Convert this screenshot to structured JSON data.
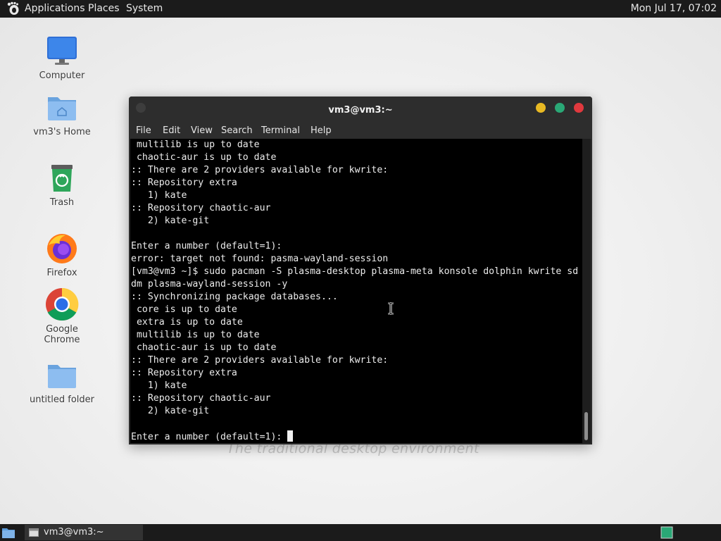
{
  "top_panel": {
    "menus": [
      "Applications",
      "Places",
      "System"
    ],
    "clock": "Mon Jul 17, 07:02"
  },
  "desktop": {
    "icons": [
      {
        "label": "Computer",
        "icon": "monitor-icon"
      },
      {
        "label": "vm3's Home",
        "icon": "home-folder-icon"
      },
      {
        "label": "Trash",
        "icon": "trash-icon"
      },
      {
        "label": "Firefox",
        "icon": "firefox-icon"
      },
      {
        "label": "Google Chrome",
        "icon": "chrome-icon"
      },
      {
        "label": "untitled folder",
        "icon": "folder-icon"
      }
    ],
    "wallpaper_text": "The traditional desktop environment"
  },
  "terminal": {
    "title": "vm3@vm3:~",
    "menu": [
      "File",
      "Edit",
      "View",
      "Search",
      "Terminal",
      "Help"
    ],
    "lines": [
      " multilib is up to date",
      " chaotic-aur is up to date",
      ":: There are 2 providers available for kwrite:",
      ":: Repository extra",
      "   1) kate",
      ":: Repository chaotic-aur",
      "   2) kate-git",
      "",
      "Enter a number (default=1):",
      "error: target not found: pasma-wayland-session",
      "[vm3@vm3 ~]$ sudo pacman -S plasma-desktop plasma-meta konsole dolphin kwrite sd",
      "dm plasma-wayland-session -y",
      ":: Synchronizing package databases...",
      " core is up to date",
      " extra is up to date",
      " multilib is up to date",
      " chaotic-aur is up to date",
      ":: There are 2 providers available for kwrite:",
      ":: Repository extra",
      "   1) kate",
      ":: Repository chaotic-aur",
      "   2) kate-git",
      ""
    ],
    "prompt_line": "Enter a number (default=1): ",
    "button_colors": {
      "minimize": "#e8b923",
      "maximize": "#2aa876",
      "close": "#e0393e"
    }
  },
  "bottom_panel": {
    "task_label": "vm3@vm3:~"
  }
}
